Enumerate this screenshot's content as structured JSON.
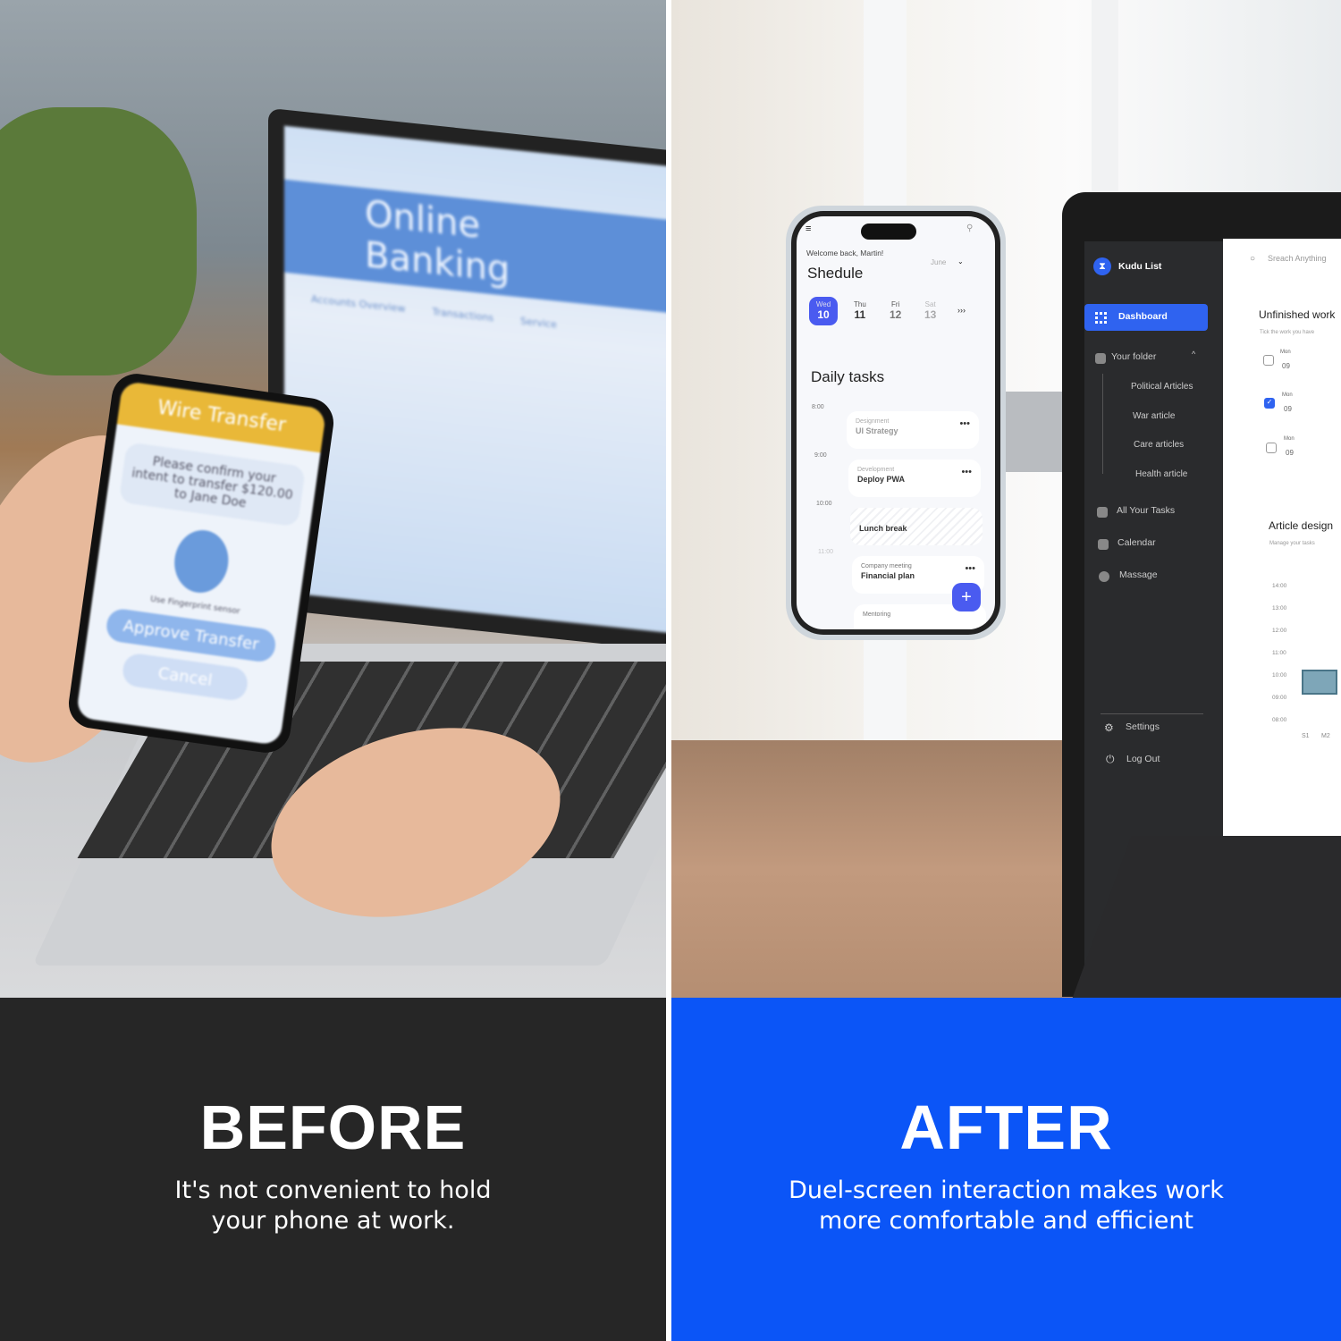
{
  "before": {
    "heading": "BEFORE",
    "line1": "It's not convenient to hold",
    "line2": "your phone at work.",
    "background": "#262626",
    "laptop_screen": {
      "title": "Online Banking",
      "rows": [
        "Accounts Overview",
        "Transactions",
        "Service"
      ]
    },
    "phone": {
      "header": "Wire Transfer",
      "message": "Please confirm your intent to transfer $120.00 to Jane Doe",
      "fingerprint_label": "Use Fingerprint sensor",
      "approve": "Approve Transfer",
      "cancel": "Cancel",
      "header_color": "#e9b838"
    }
  },
  "after": {
    "heading": "AFTER",
    "line1": "Duel-screen interaction makes work",
    "line2": "more comfortable and efficient",
    "background": "#0b55f7",
    "phone_app": {
      "welcome": "Welcome back, Martin!",
      "title": "Shedule",
      "month": "June",
      "days": [
        {
          "dow": "Wed",
          "num": "10",
          "selected": true
        },
        {
          "dow": "Thu",
          "num": "11"
        },
        {
          "dow": "Fri",
          "num": "12"
        },
        {
          "dow": "Sat",
          "num": "13"
        }
      ],
      "more": "›››",
      "section": "Daily tasks",
      "times": [
        "8:00",
        "9:00",
        "10:00",
        "11:00"
      ],
      "tasks": [
        {
          "category": "Designment",
          "name": "UI Strategy"
        },
        {
          "category": "Development",
          "name": "Deploy PWA"
        },
        {
          "category": "",
          "name": "Lunch break"
        },
        {
          "category": "Company meeting",
          "name": "Financial plan"
        },
        {
          "category": "Mentoring",
          "name": ""
        }
      ],
      "fab": "+",
      "accent": "#4a5bf0"
    },
    "laptop_app": {
      "brand": "Kudu List",
      "search_placeholder": "Sreach Anything",
      "nav": {
        "dashboard": "Dashboard",
        "folder": "Your folder",
        "folder_items": [
          "Political Articles",
          "War article",
          "Care articles",
          "Health article"
        ],
        "all_tasks": "All Your Tasks",
        "calendar": "Calendar",
        "message": "Massage",
        "settings": "Settings",
        "logout": "Log Out"
      },
      "unfinished_title": "Unfinished work",
      "unfinished_sub": "Tick the work you have",
      "work_items": [
        {
          "dow": "Mon",
          "num": "09",
          "checked": false
        },
        {
          "dow": "Mon",
          "num": "09",
          "checked": true
        },
        {
          "dow": "Mon",
          "num": "09",
          "checked": false
        }
      ],
      "article_title": "Article design",
      "article_sub": "Manage your tasks",
      "hours": [
        "14:00",
        "13:00",
        "12:00",
        "11:00",
        "10:00",
        "09:00",
        "08:00"
      ],
      "x_labels": [
        "S1",
        "M2"
      ],
      "accent": "#2f63f0"
    }
  }
}
